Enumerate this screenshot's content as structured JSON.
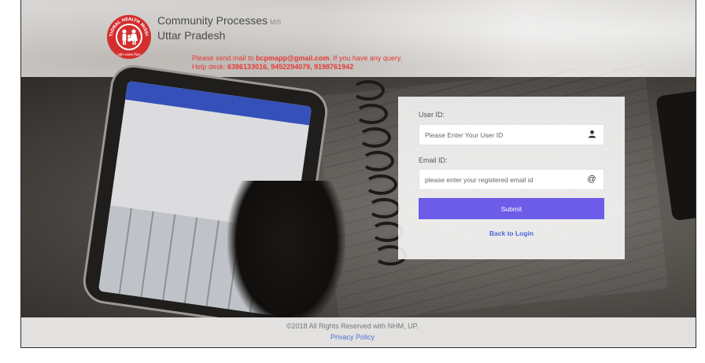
{
  "header": {
    "app_title": "Community Processes",
    "app_title_suffix": "MIS",
    "state": "Uttar Pradesh",
    "logo_text_top": "NATIONAL HEALTH MISSION",
    "logo_text_bottom": "राष्ट्रीय स्वास्थ्य मिशन",
    "notice_line1_prefix": "Please send mail to ",
    "notice_email": "bcpmapp@gmail.com",
    "notice_line1_suffix": ". If you have any query.",
    "notice_line2_prefix": "Help desk: ",
    "notice_phones": "6386133016, 9452294079, 9198761942"
  },
  "form": {
    "user_id_label": "User ID:",
    "user_id_placeholder": "Please Enter Your User ID",
    "user_id_icon": "user-icon",
    "email_label": "Email ID:",
    "email_placeholder": "please enter your registered email id",
    "email_icon": "at-icon",
    "submit_label": "Submit",
    "back_label": "Back to Login"
  },
  "footer": {
    "copyright": "©2018 All Rights Reserved with NHM, UP.",
    "privacy_label": "Privacy Policy"
  },
  "colors": {
    "accent": "#6c5ce7",
    "link": "#4a67d6",
    "notice": "#e53935",
    "logo_red": "#d32f2f"
  }
}
